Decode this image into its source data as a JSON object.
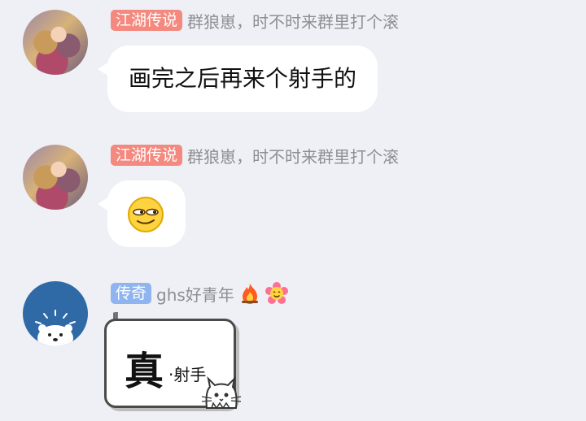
{
  "messages": [
    {
      "badge": "江湖传说",
      "nick": "群狼崽，时不时来群里打个滚",
      "text": "画完之后再来个射手的"
    },
    {
      "badge": "江湖传说",
      "nick": "群狼崽，时不时来群里打个滚",
      "emoji": "smirk-emoji"
    },
    {
      "badge": "传奇",
      "nick": "ghs好青年",
      "sticker": {
        "big": "真",
        "small": "·射手",
        "ticks": "Ill"
      }
    }
  ],
  "colors": {
    "badge_red": "#f3897f",
    "badge_blue": "#8fb4ef",
    "bg": "#eef0f5"
  },
  "icons": [
    "fire-icon",
    "flower-face-icon",
    "cat-icon"
  ]
}
